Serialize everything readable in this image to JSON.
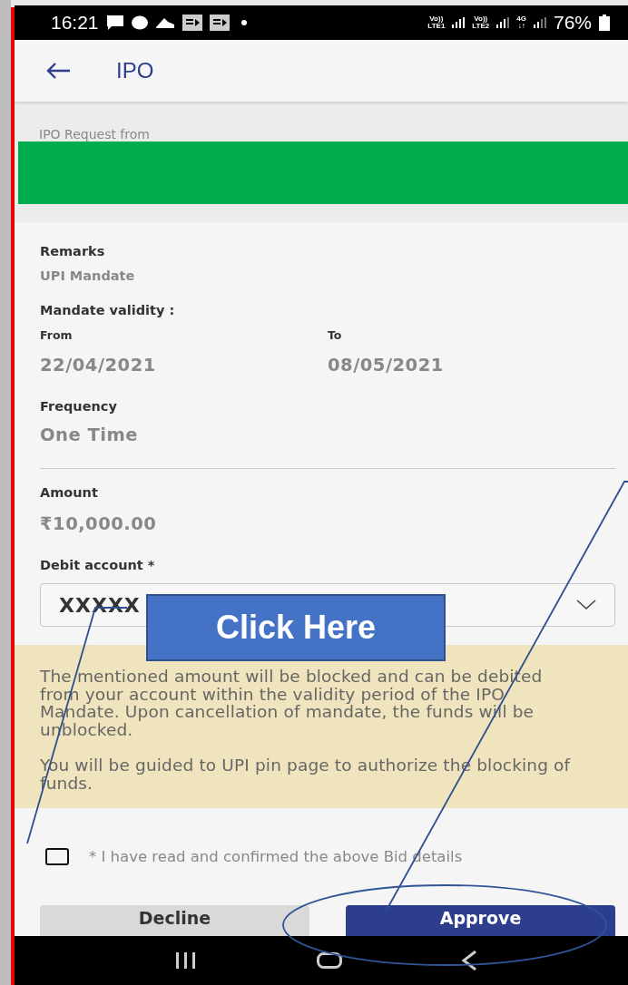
{
  "status_bar": {
    "time": "16:21",
    "network": [
      {
        "top": "Vo))",
        "bottom": "LTE1"
      },
      {
        "top": "Vo))",
        "bottom": "LTE2"
      },
      {
        "top": "4G",
        "bottom": "↓↑"
      }
    ],
    "battery": "76%"
  },
  "header": {
    "title": "IPO"
  },
  "request": {
    "label": "IPO Request from"
  },
  "remarks": {
    "label": "Remarks",
    "value": "UPI Mandate"
  },
  "validity": {
    "label": "Mandate validity :",
    "from": {
      "label": "From",
      "value": "22/04/2021"
    },
    "to": {
      "label": "To",
      "value": "08/05/2021"
    }
  },
  "frequency": {
    "label": "Frequency",
    "value": "One Time"
  },
  "amount": {
    "label": "Amount",
    "value": "₹10,000.00"
  },
  "debit_account": {
    "label": "Debit account *",
    "value": "XXXXX"
  },
  "notice": [
    "The mentioned amount will be blocked and can be debited from your account within the validity period of the IPO Mandate. Upon cancellation of mandate, the funds will be unblocked.",
    "You will be guided to UPI pin page to authorize the blocking of funds."
  ],
  "consent": {
    "label": "* I have read and confirmed the above Bid details",
    "checked": false
  },
  "buttons": [
    {
      "label": "Decline",
      "kind": "secondary"
    },
    {
      "label": "Approve",
      "kind": "primary"
    }
  ],
  "annotation": {
    "callout": "Click Here"
  }
}
